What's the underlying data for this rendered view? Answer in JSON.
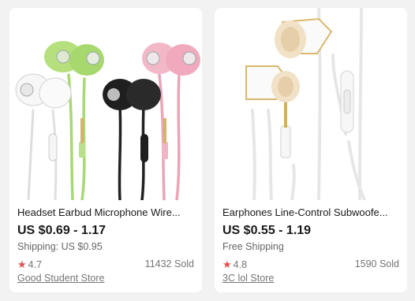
{
  "products": [
    {
      "title": "Headset Earbud Microphone Wire...",
      "price": "US $0.69 - 1.17",
      "shipping": "Shipping: US $0.95",
      "rating_icon": "star-icon",
      "rating": "4.7",
      "sold": "11432 Sold",
      "store": "Good Student Store",
      "colors": {
        "star": "#e84d4d"
      }
    },
    {
      "title": "Earphones Line-Control Subwoofe...",
      "price": "US $0.55 - 1.19",
      "shipping": "Free Shipping",
      "rating_icon": "star-icon",
      "rating": "4.8",
      "sold": "1590 Sold",
      "store": "3C lol Store",
      "colors": {
        "star": "#e84d4d"
      }
    }
  ]
}
